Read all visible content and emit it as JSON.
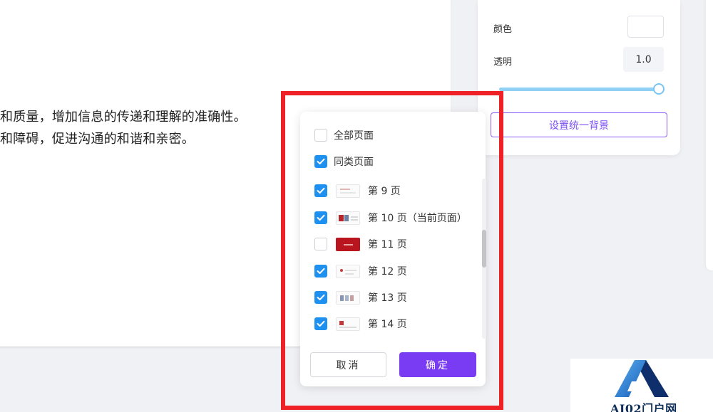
{
  "document": {
    "line1": "和质量，增加信息的传递和理解的准确性。",
    "line2": "和障碍，促进沟通的和谐和亲密。"
  },
  "background_panel": {
    "color_label": "颜色",
    "opacity_label": "透明",
    "opacity_value": "1.0",
    "opacity_slider_level": 1.0,
    "slider_color": "#8fd0f4",
    "unify_button_label": "设置统一背景",
    "accent_color": "#7a4ef0"
  },
  "apply_popup": {
    "all_pages": {
      "label": "全部页面",
      "checked": false
    },
    "same_type_pages": {
      "label": "同类页面",
      "checked": true
    },
    "pages": [
      {
        "label": "第 9 页",
        "checked": true
      },
      {
        "label": "第 10 页（当前页面）",
        "checked": true
      },
      {
        "label": "第 11 页",
        "checked": false
      },
      {
        "label": "第 12 页",
        "checked": true
      },
      {
        "label": "第 13 页",
        "checked": true
      },
      {
        "label": "第 14 页",
        "checked": true
      }
    ],
    "cancel_label": "取消",
    "confirm_label": "确定",
    "checkbox_color": "#1e90f0",
    "confirm_color": "#7a3cf3"
  },
  "highlight_color": "#ee2127",
  "watermark": {
    "text": "AI02门户网"
  }
}
